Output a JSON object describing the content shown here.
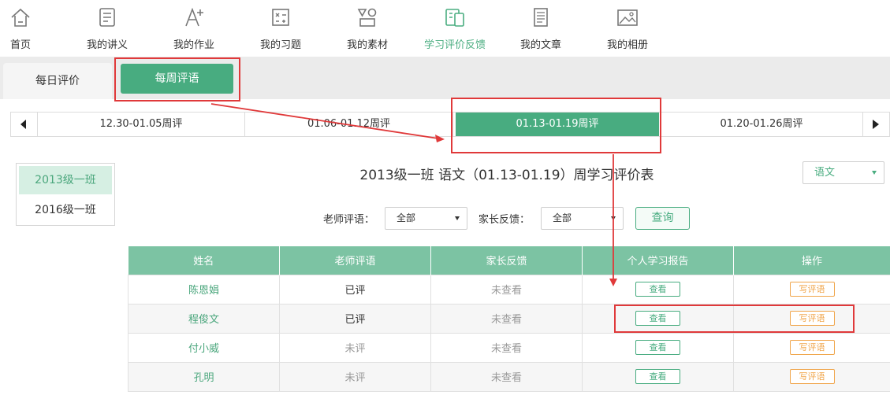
{
  "nav": [
    {
      "label": "首页",
      "icon": "home-icon"
    },
    {
      "label": "我的讲义",
      "icon": "handout-icon"
    },
    {
      "label": "我的作业",
      "icon": "homework-icon"
    },
    {
      "label": "我的习题",
      "icon": "exercise-icon"
    },
    {
      "label": "我的素材",
      "icon": "material-icon"
    },
    {
      "label": "学习评价反馈",
      "icon": "feedback-icon"
    },
    {
      "label": "我的文章",
      "icon": "article-icon"
    },
    {
      "label": "我的相册",
      "icon": "album-icon"
    }
  ],
  "nav_active": "学习评价反馈",
  "tabs": {
    "daily": "每日评价",
    "weekly": "每周评语"
  },
  "weeks": [
    "12.30-01.05周评",
    "01.06-01.12周评",
    "01.13-01.19周评",
    "01.20-01.26周评"
  ],
  "active_week": "01.13-01.19周评",
  "classes": [
    "2013级一班",
    "2016级一班"
  ],
  "page_title": "2013级一班 语文（01.13-01.19）周学习评价表",
  "subject_select": "语文",
  "filters": {
    "teacher_label": "老师评语：",
    "teacher_value": "全部",
    "parent_label": "家长反馈：",
    "parent_value": "全部",
    "query_label": "查询"
  },
  "table": {
    "headers": [
      "姓名",
      "老师评语",
      "家长反馈",
      "个人学习报告",
      "操作"
    ],
    "rows": [
      {
        "name": "陈恩娟",
        "teacher": "已评",
        "parent": "未查看",
        "report": "查看",
        "action": "写评语"
      },
      {
        "name": "程俊文",
        "teacher": "已评",
        "parent": "未查看",
        "report": "查看",
        "action": "写评语"
      },
      {
        "name": "付小威",
        "teacher": "未评",
        "parent": "未查看",
        "report": "查看",
        "action": "写评语"
      },
      {
        "name": "孔明",
        "teacher": "未评",
        "parent": "未查看",
        "report": "查看",
        "action": "写评语"
      }
    ]
  },
  "colors": {
    "brand_green": "#48ac80",
    "header_green": "#7cc3a3",
    "orange": "#f0a54a",
    "annotation_red": "#e0393a"
  }
}
